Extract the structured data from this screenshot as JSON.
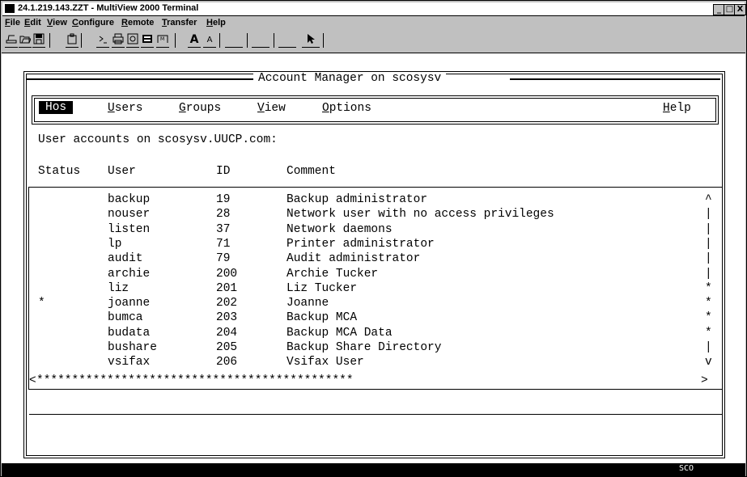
{
  "window": {
    "title": "24.1.219.143.ZZT - MultiView 2000 Terminal",
    "controls": [
      "_",
      "□",
      "X"
    ]
  },
  "menubar": {
    "items": [
      {
        "label": "File",
        "accel": "F",
        "rest": "ile"
      },
      {
        "label": "Edit",
        "accel": "E",
        "rest": "dit"
      },
      {
        "label": "View",
        "accel": "V",
        "rest": "iew"
      },
      {
        "label": "Configure",
        "accel": "C",
        "rest": "onfigure"
      },
      {
        "label": "Remote",
        "accel": "R",
        "rest": "emote"
      },
      {
        "label": "Transfer",
        "accel": "T",
        "rest": "ransfer"
      },
      {
        "label": "Help",
        "accel": "H",
        "rest": "elp"
      }
    ]
  },
  "toolbar": {
    "icons": [
      "print-icon",
      "open-icon",
      "save-icon",
      "paste-icon",
      "command-icon",
      "printer-icon",
      "connect-icon",
      "keyboard-icon",
      "macro-icon",
      "font-large-icon",
      "font-small-icon",
      "blank-1-icon",
      "blank-2-icon",
      "blank-3-icon",
      "pointer-icon"
    ],
    "font_large": "A",
    "font_small": "A"
  },
  "terminal": {
    "frame_title": "Account Manager on scosysv",
    "menu": {
      "hos": "Hos",
      "users": {
        "accel": "U",
        "rest": "sers"
      },
      "groups": {
        "accel": "G",
        "rest": "roups"
      },
      "view": {
        "accel": "V",
        "rest": "iew"
      },
      "options": {
        "accel": "O",
        "rest": "ptions"
      },
      "help": {
        "accel": "H",
        "rest": "elp"
      }
    },
    "subtitle": "User accounts on scosysv.UUCP.com:",
    "columns": {
      "status": "Status",
      "user": "User",
      "id": "ID",
      "comment": "Comment"
    },
    "rows": [
      {
        "status": "",
        "user": "backup",
        "id": "19",
        "comment": "Backup administrator",
        "scroll": "^"
      },
      {
        "status": "",
        "user": "nouser",
        "id": "28",
        "comment": "Network user with no access privileges",
        "scroll": "|"
      },
      {
        "status": "",
        "user": "listen",
        "id": "37",
        "comment": "Network daemons",
        "scroll": "|"
      },
      {
        "status": "",
        "user": "lp",
        "id": "71",
        "comment": "Printer administrator",
        "scroll": "|"
      },
      {
        "status": "",
        "user": "audit",
        "id": "79",
        "comment": "Audit administrator",
        "scroll": "|"
      },
      {
        "status": "",
        "user": "archie",
        "id": "200",
        "comment": "Archie Tucker",
        "scroll": "|"
      },
      {
        "status": "",
        "user": "liz",
        "id": "201",
        "comment": "Liz Tucker",
        "scroll": "*"
      },
      {
        "status": "*",
        "user": "joanne",
        "id": "202",
        "comment": "Joanne",
        "scroll": "*"
      },
      {
        "status": "",
        "user": "bumca",
        "id": "203",
        "comment": "Backup MCA",
        "scroll": "*"
      },
      {
        "status": "",
        "user": "budata",
        "id": "204",
        "comment": "Backup MCA Data",
        "scroll": "*"
      },
      {
        "status": "",
        "user": "bushare",
        "id": "205",
        "comment": "Backup Share Directory",
        "scroll": "|"
      },
      {
        "status": "",
        "user": "vsifax",
        "id": "206",
        "comment": "Vsifax User",
        "scroll": "v"
      }
    ],
    "hscroll_left": "<",
    "hscroll_thumb": "*********************************************",
    "hscroll_right": ">"
  },
  "statusbar": {
    "text": "SCO"
  },
  "colors": {
    "chrome": "#c0c0c0",
    "terminal_bg": "#ffffff",
    "text": "#000000",
    "statusbar": "#000000"
  }
}
